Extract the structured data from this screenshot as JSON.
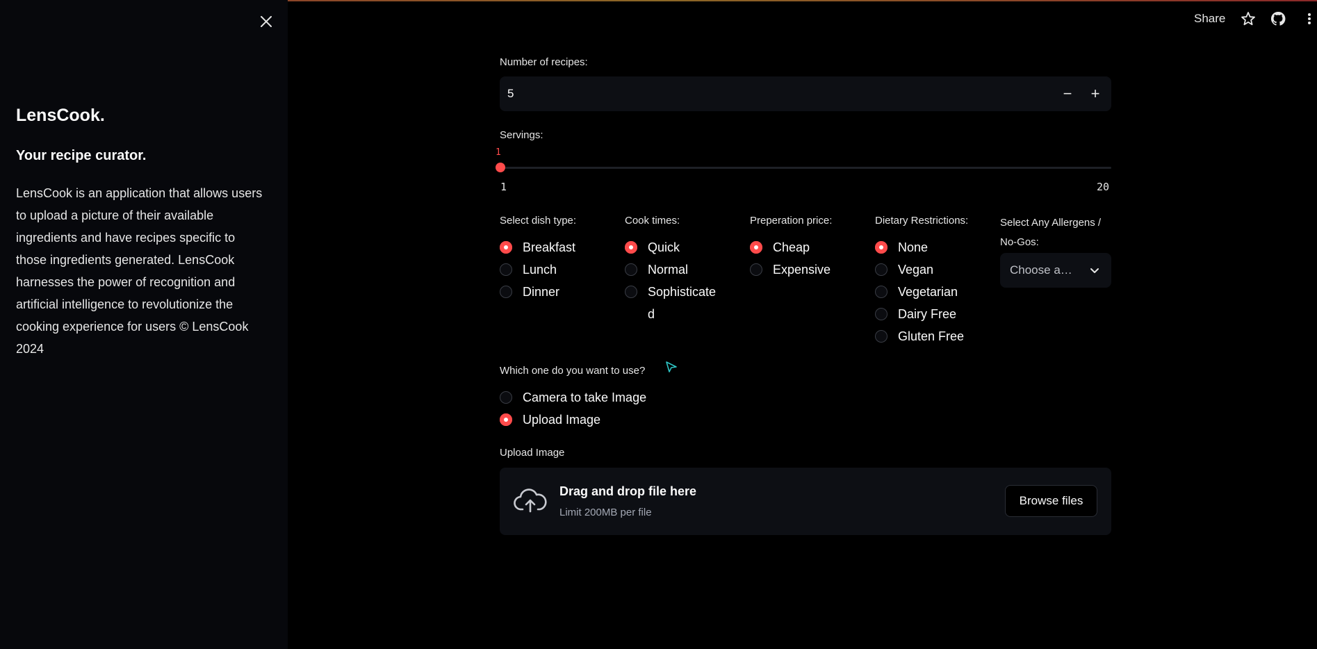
{
  "sidebar": {
    "title": "LensCook.",
    "subtitle": "Your recipe curator.",
    "description": "LensCook is an application that allows users to upload a picture of their available ingredients and have recipes specific to those ingredients generated. LensCook harnesses the power of recognition and artificial intelligence to revolutionize the cooking experience for users © LensCook 2024",
    "close_icon": "close-icon"
  },
  "header": {
    "share_label": "Share",
    "star_icon": "star-icon",
    "github_icon": "github-icon",
    "menu_icon": "kebab-menu-icon"
  },
  "recipes": {
    "label": "Number of recipes:",
    "value": "5",
    "minus": "−",
    "plus": "+"
  },
  "servings": {
    "label": "Servings:",
    "current": "1",
    "min": "1",
    "max": "20",
    "current_value": 1,
    "min_value": 1,
    "max_value": 20
  },
  "dish_type": {
    "label": "Select dish type:",
    "options": [
      "Breakfast",
      "Lunch",
      "Dinner"
    ],
    "selected": 0
  },
  "cook_times": {
    "label": "Cook times:",
    "options": [
      "Quick",
      "Normal",
      "Sophisticate\nd"
    ],
    "selected": 0
  },
  "price": {
    "label": "Preperation price:",
    "options": [
      "Cheap",
      "Expensive"
    ],
    "selected": 0
  },
  "dietary": {
    "label": "Dietary Restrictions:",
    "options": [
      "None",
      "Vegan",
      "Vegetarian",
      "Dairy Free",
      "Gluten Free"
    ],
    "selected": 0
  },
  "allergens": {
    "label": "Select Any Allergens / No-Gos:",
    "placeholder": "Choose a…"
  },
  "source": {
    "label": "Which one do you want to use?",
    "options": [
      "Camera to take Image",
      "Upload Image"
    ],
    "selected": 1
  },
  "upload": {
    "label": "Upload Image",
    "drop_title": "Drag and drop file here",
    "limit": "Limit 200MB per file",
    "browse_label": "Browse files"
  },
  "colors": {
    "accent": "#ff4b4b",
    "background": "#000000",
    "sidebar": "#07080c",
    "widget": "#0d0f14"
  }
}
